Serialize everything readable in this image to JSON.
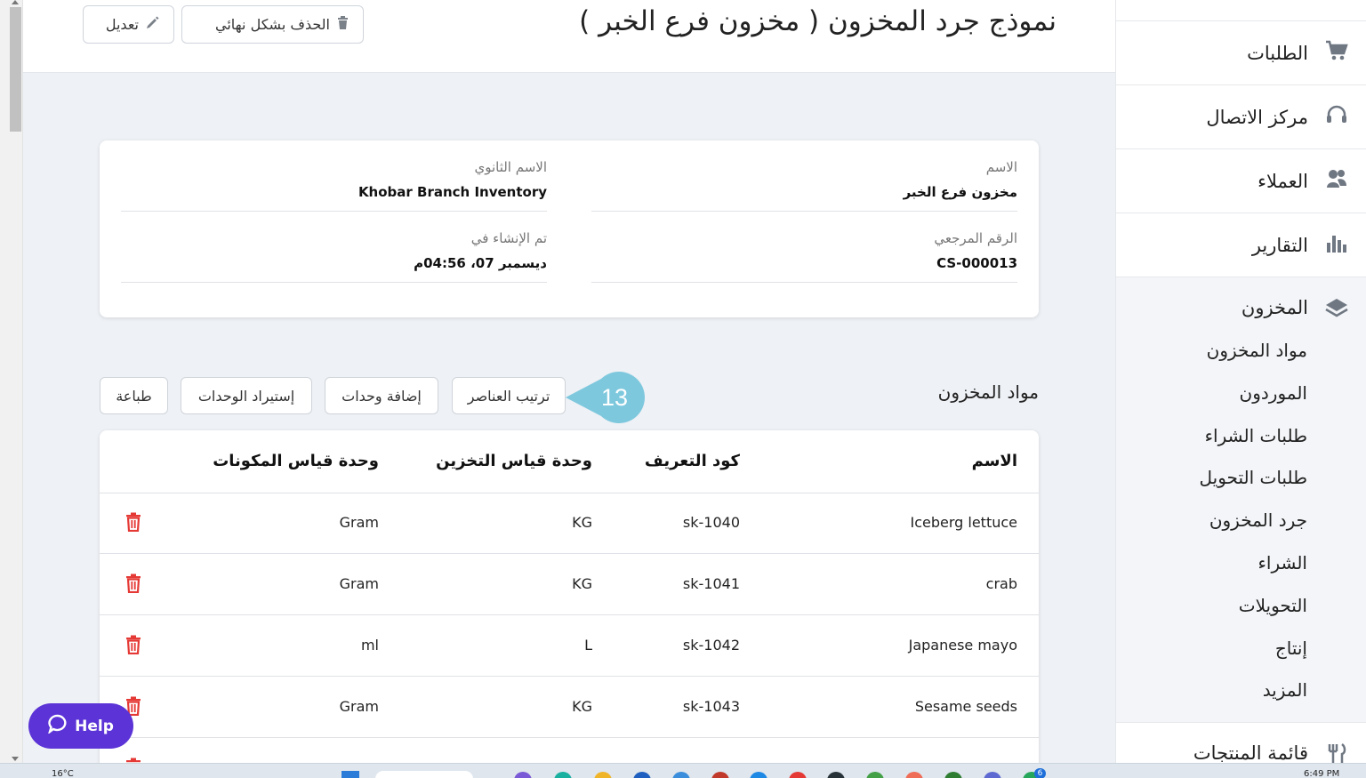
{
  "header": {
    "title": "نموذج جرد المخزون ( مخزون فرع الخبر )",
    "delete_label": "الحذف بشكل نهائي",
    "edit_label": "تعديل"
  },
  "sidebar": {
    "items": [
      {
        "label": "الطلبات",
        "icon": "cart-icon"
      },
      {
        "label": "مركز الاتصال",
        "icon": "headset-icon"
      },
      {
        "label": "العملاء",
        "icon": "users-icon"
      },
      {
        "label": "التقارير",
        "icon": "bar-chart-icon"
      },
      {
        "label": "المخزون",
        "icon": "layers-icon"
      }
    ],
    "subitems": [
      "مواد المخزون",
      "الموردون",
      "طلبات الشراء",
      "طلبات التحويل",
      "جرد المخزون",
      "الشراء",
      "التحويلات",
      "إنتاج",
      "المزيد"
    ],
    "bottom_item": {
      "label": "قائمة المنتجات",
      "icon": "fork-knife-icon"
    }
  },
  "info": {
    "name_label": "الاسم",
    "name_value": "مخزون فرع الخبر",
    "secondary_label": "الاسم الثانوي",
    "secondary_value": "Khobar Branch Inventory",
    "ref_label": "الرقم المرجعي",
    "ref_value": "CS-000013",
    "created_label": "تم الإنشاء في",
    "created_value": "ديسمبر 07، 04:56م"
  },
  "items": {
    "title": "مواد المخزون",
    "sort_label": "ترتيب العناصر",
    "add_label": "إضافة وحدات",
    "import_label": "إستيراد الوحدات",
    "print_label": "طباعة",
    "step_number": "13",
    "columns": [
      "الاسم",
      "كود التعريف",
      "وحدة قياس التخزين",
      "وحدة قياس المكونات"
    ],
    "rows": [
      {
        "name": "Iceberg lettuce",
        "sku": "sk-1040",
        "storage_unit": "KG",
        "ingredient_unit": "Gram"
      },
      {
        "name": "crab",
        "sku": "sk-1041",
        "storage_unit": "KG",
        "ingredient_unit": "Gram"
      },
      {
        "name": "Japanese mayo",
        "sku": "sk-1042",
        "storage_unit": "L",
        "ingredient_unit": "ml"
      },
      {
        "name": "Sesame seeds",
        "sku": "sk-1043",
        "storage_unit": "KG",
        "ingredient_unit": "Gram"
      }
    ]
  },
  "help": {
    "label": "Help"
  },
  "taskbar": {
    "temperature": "16°C",
    "clock": "6:49 PM",
    "badge": "6"
  },
  "colors": {
    "danger": "#e53935",
    "help": "#5b33d6",
    "step_badge": "#7ec8de"
  }
}
